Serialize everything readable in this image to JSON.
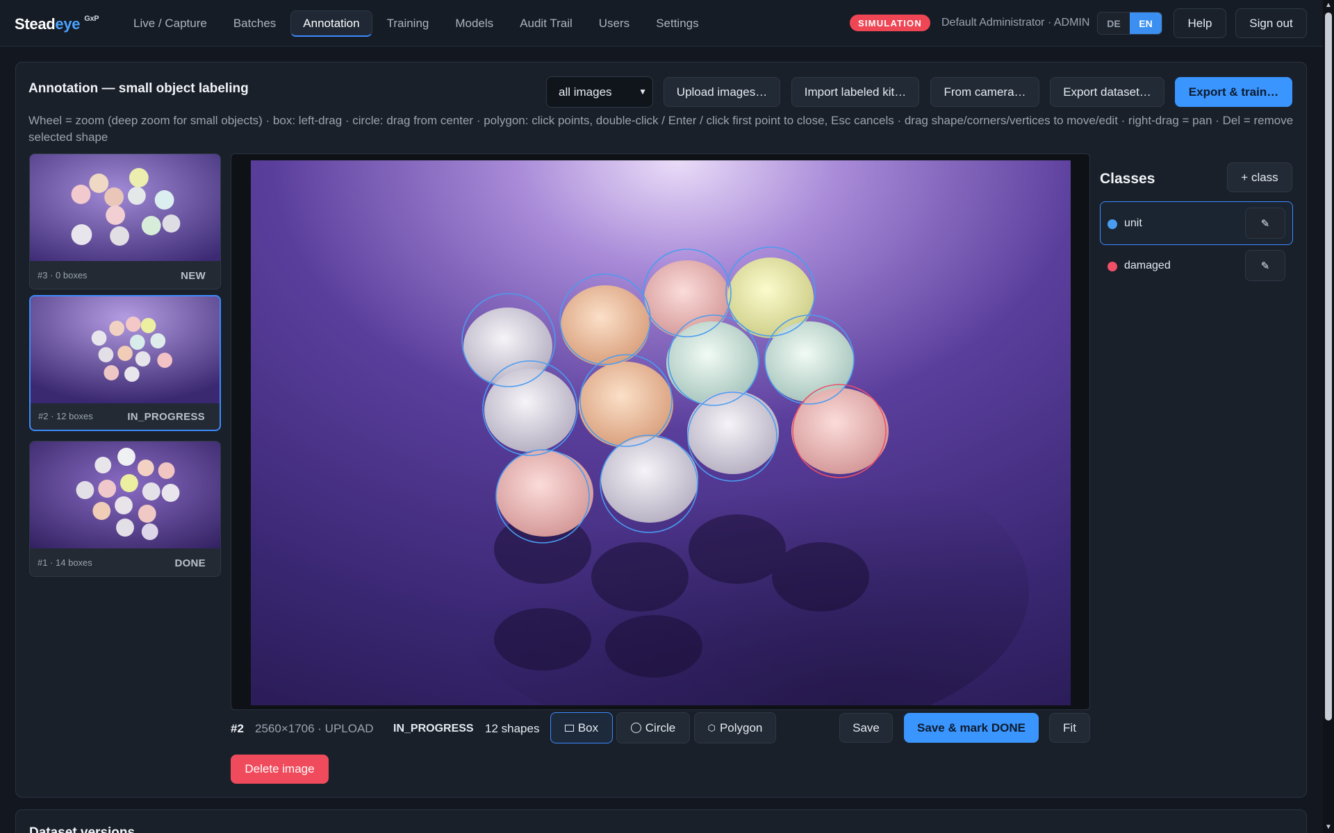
{
  "brand": {
    "name_a": "Stead",
    "name_b": "eye",
    "suffix": "GxP"
  },
  "nav": {
    "links": [
      "Live / Capture",
      "Batches",
      "Annotation",
      "Training",
      "Models",
      "Audit Trail",
      "Users",
      "Settings"
    ],
    "active": "Annotation",
    "simulation_badge": "SIMULATION",
    "user": "Default Administrator · ADMIN",
    "lang": [
      "DE",
      "EN"
    ],
    "lang_active": "EN",
    "help": "Help",
    "signout": "Sign out"
  },
  "annotation": {
    "title": "Annotation — small object labeling",
    "hint": "Wheel = zoom (deep zoom for small objects) · box: left-drag · circle: drag from center · polygon: click points, double-click / Enter / click first point to close, Esc cancels · drag shape/corners/vertices to move/edit · right-drag = pan · Del = remove selected shape",
    "filter_value": "all images",
    "toolbar": {
      "upload": "Upload images…",
      "import": "Import labeled kit…",
      "camera": "From camera…",
      "export": "Export dataset…",
      "export_train": "Export & train…"
    }
  },
  "thumbnails": [
    {
      "meta": "#3 · 0 boxes",
      "status": "NEW"
    },
    {
      "meta": "#2 · 12 boxes",
      "status": "IN_PROGRESS"
    },
    {
      "meta": "#1 · 14 boxes",
      "status": "DONE"
    }
  ],
  "current_image": {
    "id": "#2",
    "dims": "2560×1706 · UPLOAD",
    "state": "IN_PROGRESS",
    "shapes": "12 shapes"
  },
  "tools": {
    "box": "Box",
    "circle": "Circle",
    "polygon": "Polygon",
    "active": "Box"
  },
  "actions": {
    "save": "Save",
    "save_done": "Save & mark DONE",
    "fit": "Fit",
    "delete": "Delete image"
  },
  "classes": {
    "title": "Classes",
    "add": "+ class",
    "items": [
      {
        "name": "unit",
        "color": "#4a9cf0"
      },
      {
        "name": "damaged",
        "color": "#ef4f67"
      }
    ]
  },
  "dataset_versions_title": "Dataset versions",
  "colors": {
    "accent": "#3a95ff",
    "danger": "#f04b5c",
    "unit": "#4a9cf0",
    "damaged": "#ef4f67"
  }
}
